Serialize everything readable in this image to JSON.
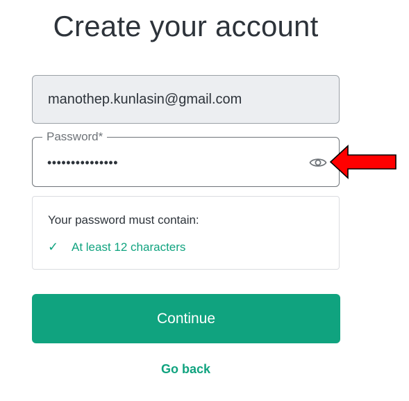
{
  "page": {
    "title": "Create your account"
  },
  "email_field": {
    "value": "manothep.kunlasin@gmail.com"
  },
  "password_field": {
    "label": "Password*",
    "masked_value": "•••••••••••••••",
    "toggle_icon": "eye-icon"
  },
  "requirements": {
    "title": "Your password must contain:",
    "items": [
      {
        "check": "✓",
        "text": "At least 12 characters"
      }
    ]
  },
  "actions": {
    "continue_label": "Continue",
    "go_back_label": "Go back"
  },
  "colors": {
    "accent": "#10a37f",
    "annotation_arrow": "#ff0000",
    "email_field_bg": "#eceef1",
    "text": "#2d333a"
  }
}
